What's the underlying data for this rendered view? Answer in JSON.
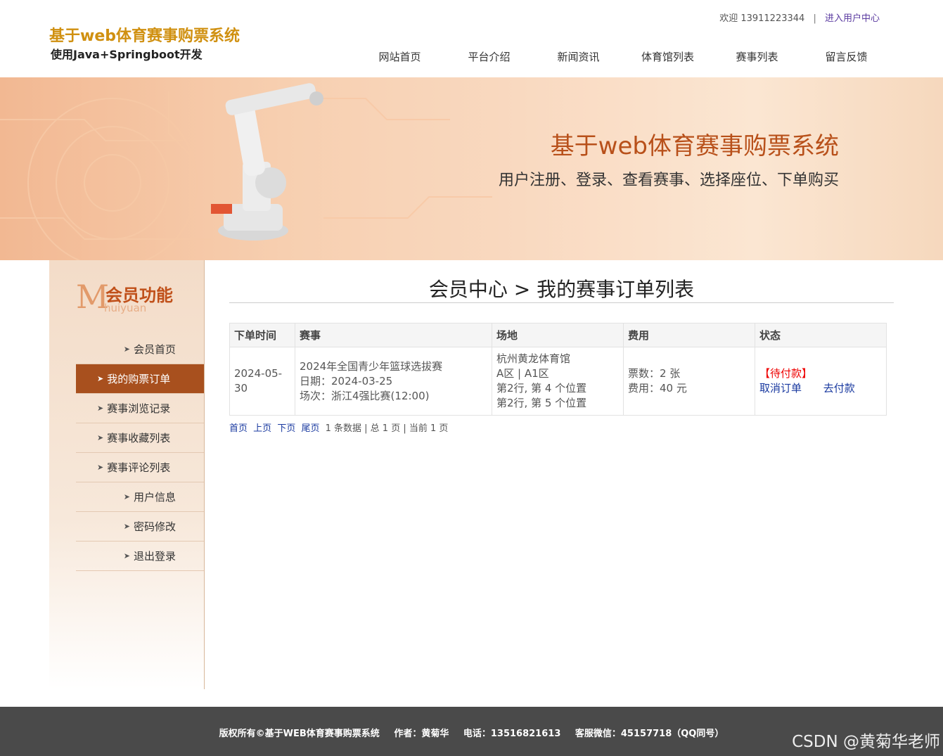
{
  "header": {
    "logo_title": "基于web体育赛事购票系统",
    "logo_subtitle": "使用Java+Springboot开发",
    "welcome_text": "欢迎 13911223344",
    "separator": "|",
    "user_center_link": "进入用户中心",
    "nav": [
      "网站首页",
      "平台介绍",
      "新闻资讯",
      "体育馆列表",
      "赛事列表",
      "留言反馈"
    ]
  },
  "banner": {
    "title": "基于web体育赛事购票系统",
    "subtitle": "用户注册、登录、查看赛事、选择座位、下单购买"
  },
  "sidebar": {
    "heading_letter": "M",
    "heading_cn": "会员功能",
    "heading_en": "huiyuan",
    "items": [
      "会员首页",
      "我的购票订单",
      "赛事浏览记录",
      "赛事收藏列表",
      "赛事评论列表",
      "用户信息",
      "密码修改",
      "退出登录"
    ],
    "active_index": 1
  },
  "main": {
    "page_title": "会员中心 > 我的赛事订单列表",
    "table": {
      "headers": [
        "下单时间",
        "赛事",
        "场地",
        "费用",
        "状态"
      ],
      "rows": [
        {
          "order_time": "2024-05-30",
          "event_name": "2024年全国青少年篮球选拔赛",
          "event_date": "日期：2024-03-25",
          "event_round": "场次：浙江4强比赛(12:00)",
          "venue_name": "杭州黄龙体育馆",
          "venue_area": "A区 | A1区",
          "seat_1": "第2行, 第 4 个位置",
          "seat_2": "第2行, 第 5 个位置",
          "ticket_count": "票数：2 张",
          "fee": "费用：40 元",
          "status": "【待付款】",
          "cancel_link": "取消订单",
          "pay_link": "去付款"
        }
      ]
    },
    "pager": {
      "first": "首页",
      "prev": "上页",
      "next": "下页",
      "last": "尾页",
      "summary": "1 条数据 | 总 1 页 | 当前 1 页"
    }
  },
  "footer": {
    "copyright": "版权所有©基于WEB体育赛事购票系统",
    "author": "作者：黄菊华",
    "phone": "电话：13516821613",
    "wechat": "客服微信：45157718（QQ同号）"
  },
  "watermark": "CSDN @黄菊华老师"
}
